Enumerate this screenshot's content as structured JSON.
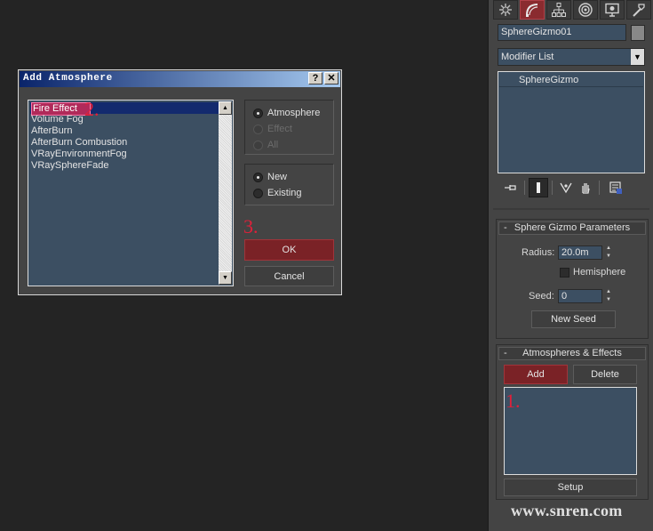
{
  "command_panel": {
    "tabs": [
      {
        "icon": "create-icon"
      },
      {
        "icon": "modify-icon"
      },
      {
        "icon": "hierarchy-icon"
      },
      {
        "icon": "motion-icon"
      },
      {
        "icon": "display-icon"
      },
      {
        "icon": "utilities-icon"
      }
    ],
    "object_name": "SphereGizmo01",
    "modifier_list": "Modifier List",
    "stack_item": "SphereGizmo",
    "sphere_gizmo_params": {
      "title": "Sphere Gizmo Parameters",
      "radius_label": "Radius:",
      "radius_value": "20.0m",
      "hemisphere_label": "Hemisphere",
      "seed_label": "Seed:",
      "seed_value": "0",
      "new_seed_button": "New Seed"
    },
    "atmospheres_effects": {
      "title": "Atmospheres & Effects",
      "add_button": "Add",
      "delete_button": "Delete",
      "setup_button": "Setup"
    }
  },
  "dialog": {
    "title": "Add Atmosphere",
    "help_button": "?",
    "close_button": "✕",
    "items": [
      "Fire Effect",
      "Volume Fog",
      "AfterBurn",
      "AfterBurn Combustion",
      "VRayEnvironmentFog",
      "VRaySphereFade"
    ],
    "selected_index": 0,
    "type_options": [
      {
        "label": "Atmosphere",
        "checked": true,
        "enabled": true
      },
      {
        "label": "Effect",
        "checked": false,
        "enabled": false
      },
      {
        "label": "All",
        "checked": false,
        "enabled": false
      }
    ],
    "source_options": [
      {
        "label": "New",
        "checked": true
      },
      {
        "label": "Existing",
        "checked": false
      }
    ],
    "ok_button": "OK",
    "cancel_button": "Cancel"
  },
  "annotations": {
    "step1": "1.",
    "step2": "2.",
    "step3": "3."
  },
  "watermark": "www.snren.com",
  "colors": {
    "accent_red": "#7a2226",
    "field_blue": "#3c4f62",
    "selection_navy": "#132a6e",
    "annotation_red": "#e0203a"
  }
}
